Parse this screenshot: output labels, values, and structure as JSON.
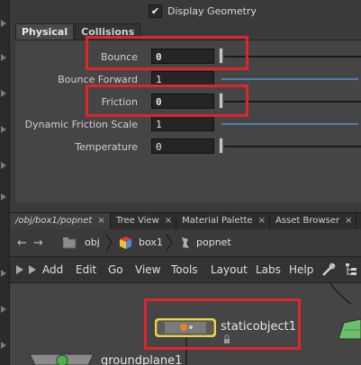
{
  "params": {
    "display_geometry": {
      "label": "Display Geometry",
      "checked": true
    },
    "tabs": [
      "Physical",
      "Collisions"
    ],
    "rows": [
      {
        "label": "Bounce",
        "value": "0",
        "bold": true,
        "highlighted": true,
        "slider_type": "handle"
      },
      {
        "label": "Bounce Forward",
        "value": "1",
        "bold": false,
        "highlighted": false,
        "slider_type": "blue"
      },
      {
        "label": "Friction",
        "value": "0",
        "bold": true,
        "highlighted": true,
        "slider_type": "handle"
      },
      {
        "label": "Dynamic Friction Scale",
        "value": "1",
        "bold": false,
        "highlighted": false,
        "slider_type": "blue"
      },
      {
        "label": "Temperature",
        "value": "0",
        "bold": false,
        "highlighted": false,
        "slider_type": "handle"
      }
    ]
  },
  "pane_tabs": [
    {
      "label": "/obj/box1/popnet",
      "active": true,
      "close": "×"
    },
    {
      "label": "Tree View",
      "active": false,
      "close": "×"
    },
    {
      "label": "Material Palette",
      "active": false,
      "close": "×"
    },
    {
      "label": "Asset Browser",
      "active": false,
      "close": "×"
    }
  ],
  "path": {
    "back_icon": "←",
    "forward_icon": "→",
    "crumbs": [
      "obj",
      "box1",
      "popnet"
    ]
  },
  "menu": [
    "Add",
    "Edit",
    "Go",
    "View",
    "Tools",
    "Layout",
    "Labs",
    "Help"
  ],
  "network": {
    "nodes": [
      {
        "label": "staticobject1",
        "highlighted": true
      },
      {
        "label": "groundplane1",
        "highlighted": false
      }
    ]
  },
  "colors": {
    "highlight": "#e0242c",
    "node_selected": "#e8d44d",
    "node_green": "#6bbf6b"
  }
}
